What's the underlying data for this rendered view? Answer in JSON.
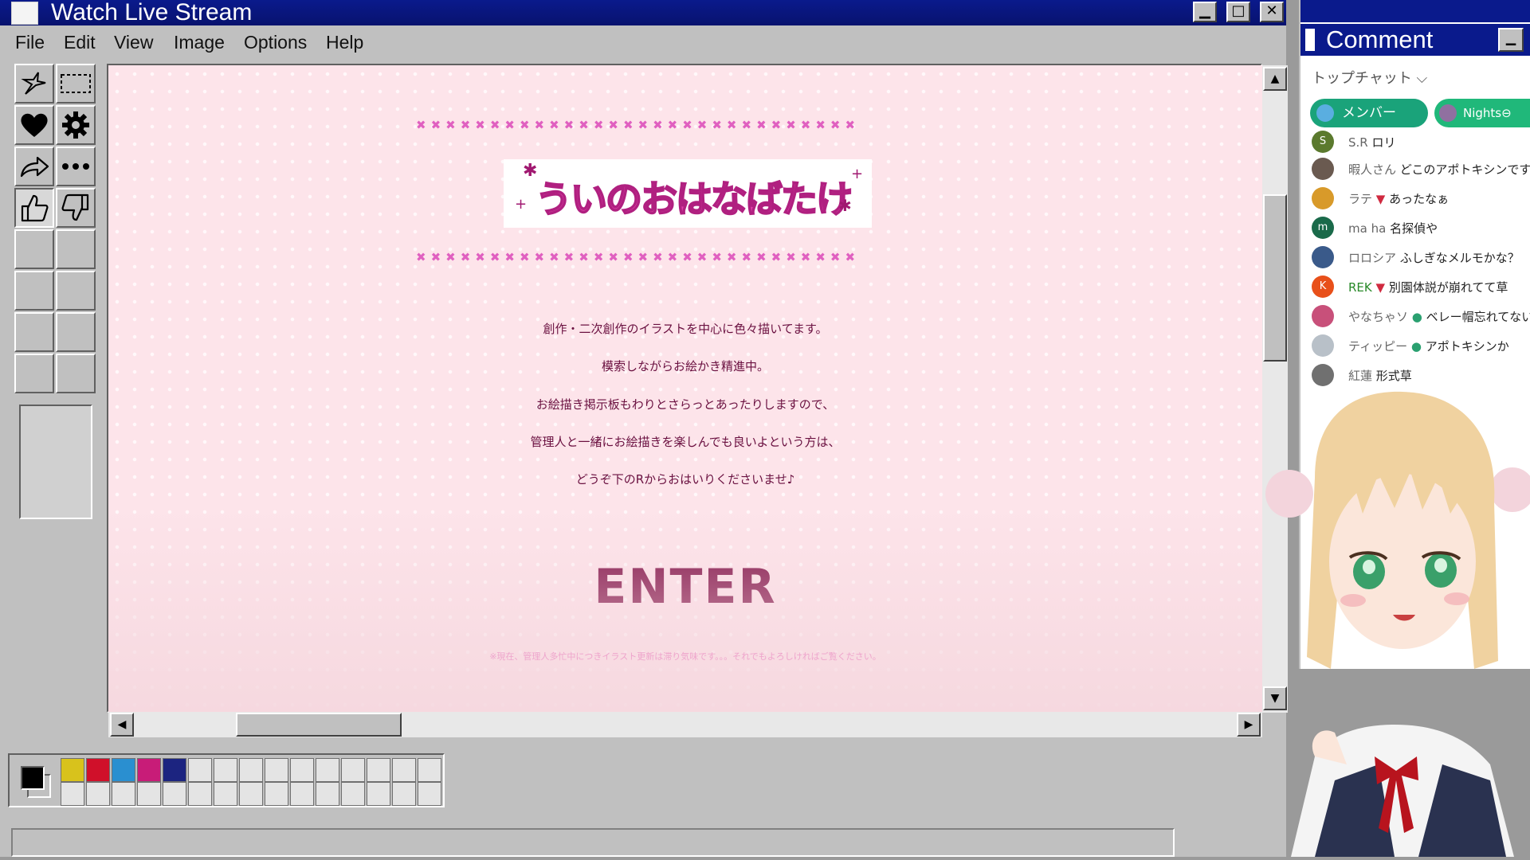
{
  "window": {
    "title": "Watch Live Stream",
    "minimize": "▁",
    "maximize": "□",
    "close": "✕"
  },
  "menubar": {
    "items": [
      "File",
      "Edit",
      "View",
      "Image",
      "Options",
      "Help"
    ]
  },
  "toolbox": {
    "tools": [
      "star-select-icon",
      "rect-select-icon",
      "heart-icon",
      "gear-icon",
      "share-icon",
      "more-icon",
      "thumbs-up-icon",
      "thumbs-down-icon"
    ]
  },
  "canvas": {
    "logo_text": "ういのおはなばたけ",
    "lines": [
      "創作・二次創作のイラストを中心に色々描いてます。",
      "模索しながらお絵かき精進中。",
      "お絵描き掲示板もわりとさらっとあったりしますので、",
      "管理人と一緒にお絵描きを楽しんでも良いよという方は、",
      "どうぞ下のRからおはいりくださいませ♪"
    ],
    "enter": "ENTER",
    "notice": "※現在、管理人多忙中につきイラスト更新は滞り気味です。。。それでもよろしければご覧ください。"
  },
  "palette": {
    "colors": [
      "#d8c21c",
      "#d0102a",
      "#2a8fd0",
      "#c81c78",
      "#1c2480"
    ],
    "primary": "#000000"
  },
  "chat": {
    "title": "Comment",
    "filter": "トップチャット ⌵",
    "chips": [
      {
        "label": "メンバー",
        "color": "#1aa37a"
      },
      {
        "label": "Nights⊖",
        "color": "#20b87a"
      }
    ],
    "messages": [
      {
        "initial": "S",
        "name": "S.R",
        "text": "ロリ",
        "color": "#5b7a2e"
      },
      {
        "initial": "",
        "name": "暇人さん",
        "text": "どこのアポトキシンです",
        "color": "#6a5a50"
      },
      {
        "initial": "",
        "name": "ラテ",
        "text": "あったなぁ",
        "color": "#d89a2a"
      },
      {
        "initial": "m",
        "name": "ma ha",
        "text": "名探偵や",
        "color": "#1a6a4a"
      },
      {
        "initial": "",
        "name": "ロロシア",
        "text": "ふしぎなメルモかな？",
        "color": "#3a5a8a"
      },
      {
        "initial": "K",
        "name": "REK",
        "text": "別園体説が崩れてて草",
        "color": "#e8501a"
      },
      {
        "initial": "",
        "name": "やなちゃソ",
        "text": "ベレー帽忘れてない",
        "color": "#c8507a"
      },
      {
        "initial": "",
        "name": "ティッピー",
        "text": "アポトキシンか",
        "color": "#b8c0c8"
      },
      {
        "initial": "",
        "name": "紅蓮",
        "text": "形式草",
        "color": "#707070"
      }
    ]
  }
}
